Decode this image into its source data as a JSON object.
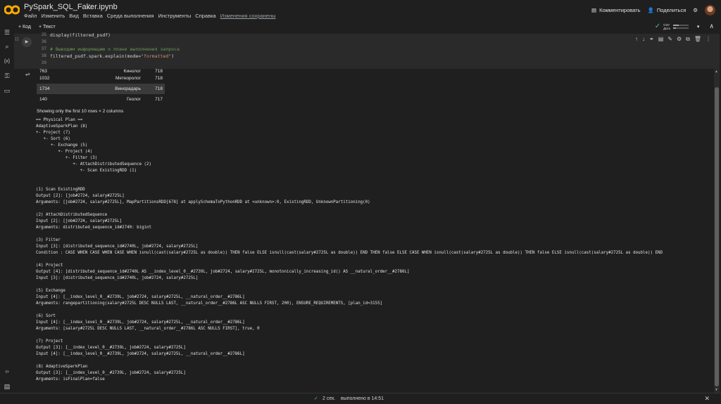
{
  "header": {
    "title": "PySpark_SQL_Faker.ipynb",
    "menus": [
      "Файл",
      "Изменить",
      "Вид",
      "Вставка",
      "Среда выполнения",
      "Инструменты",
      "Справка"
    ],
    "saved_status": "Изменения сохранены",
    "comment_label": "Комментировать",
    "share_label": "Поделиться"
  },
  "toolbar": {
    "code_label": "+ Код",
    "text_label": "+ Текст",
    "ram_label": "ОЗУ",
    "disk_label": "Диск",
    "ram_fill": 0.35,
    "disk_fill": 0.2
  },
  "cell": {
    "lines": [
      {
        "num": "35",
        "html": "display(filtered_psdf)"
      },
      {
        "num": "36",
        "html": ""
      },
      {
        "num": "37",
        "html": "<span class=\"cm\"># Выводим информацию о плане выполнения запроса</span>"
      },
      {
        "num": "38",
        "html": "filtered_psdf.spark.explain(mode=<span class=\"str\">\"formatted\"</span>)"
      },
      {
        "num": "39",
        "html": ""
      }
    ]
  },
  "output": {
    "table_rows": [
      {
        "id": "763",
        "job": "Кинолог",
        "salary": "718"
      },
      {
        "id": "1032",
        "job": "Метеоролог",
        "salary": "718"
      },
      {
        "id": "1734",
        "job": "Винорадарь",
        "salary": "718"
      },
      {
        "id": "140",
        "job": "Геолог",
        "salary": "717"
      }
    ],
    "shown_text": "Showing only the first 10 rows × 2 columns",
    "plan": [
      "== Physical Plan ==",
      "AdaptiveSparkPlan (8)",
      "+- Project (7)",
      "   +- Sort (6)",
      "      +- Exchange (5)",
      "         +- Project (4)",
      "            +- Filter (3)",
      "               +- AttachDistributedSequence (2)",
      "                  +- Scan ExistingRDD (1)",
      "",
      "",
      "(1) Scan ExistingRDD",
      "Output [2]: [job#2724, salary#2725L]",
      "Arguments: [job#2724, salary#2725L], MapPartitionsRDD[678] at applySchemaToPythonRDD at <unknown>:0, ExistingRDD, UnknownPartitioning(0)",
      "",
      "(2) AttachDistributedSequence",
      "Input [2]: [job#2724, salary#2725L]",
      "Arguments: distributed_sequence_id#2740: bigint",
      "",
      "(3) Filter",
      "Input [3]: [distributed_sequence_id#2740L, job#2724, salary#2725L]",
      "Condition : CASE WHEN CASE WHEN CASE WHEN isnull(cast(salary#2725L as double)) THEN false ELSE isnull(cast(salary#2725L as double)) END THEN false ELSE CASE WHEN isnull(cast(salary#2725L as double)) THEN false ELSE isnull(cast(salary#2725L as double)) END",
      "",
      "(4) Project",
      "Output [4]: [distributed_sequence_id#2740L AS __index_level_0__#2739L, job#2724, salary#2725L, monotonically_increasing_id() AS __natural_order__#2786L]",
      "Input [3]: [distributed_sequence_id#2740L, job#2724, salary#2725L]",
      "",
      "(5) Exchange",
      "Input [4]: [__index_level_0__#2739L, job#2724, salary#2725L, __natural_order__#2786L]",
      "Arguments: rangepartitioning(salary#2725L DESC NULLS LAST, __natural_order__#2786L ASC NULLS FIRST, 200), ENSURE_REQUIREMENTS, [plan_id=3155]",
      "",
      "(6) Sort",
      "Input [4]: [__index_level_0__#2739L, job#2724, salary#2725L, __natural_order__#2786L]",
      "Arguments: [salary#2725L DESC NULLS LAST, __natural_order__#2786L ASC NULLS FIRST], true, 0",
      "",
      "(7) Project",
      "Output [3]: [__index_level_0__#2739L, job#2724, salary#2725L]",
      "Input [4]: [__index_level_0__#2739L, job#2724, salary#2725L, __natural_order__#2786L]",
      "",
      "(8) AdaptiveSparkPlan",
      "Output [3]: [__index_level_0__#2739L, job#2724, salary#2725L]",
      "Arguments: isFinalPlan=false"
    ]
  },
  "status": {
    "duration": "2 сек.",
    "finished": "выполнено в 14:51"
  },
  "icons": {
    "sidebar": [
      "toc-icon",
      "search-icon",
      "variables-icon",
      "secrets-icon",
      "files-icon"
    ]
  }
}
